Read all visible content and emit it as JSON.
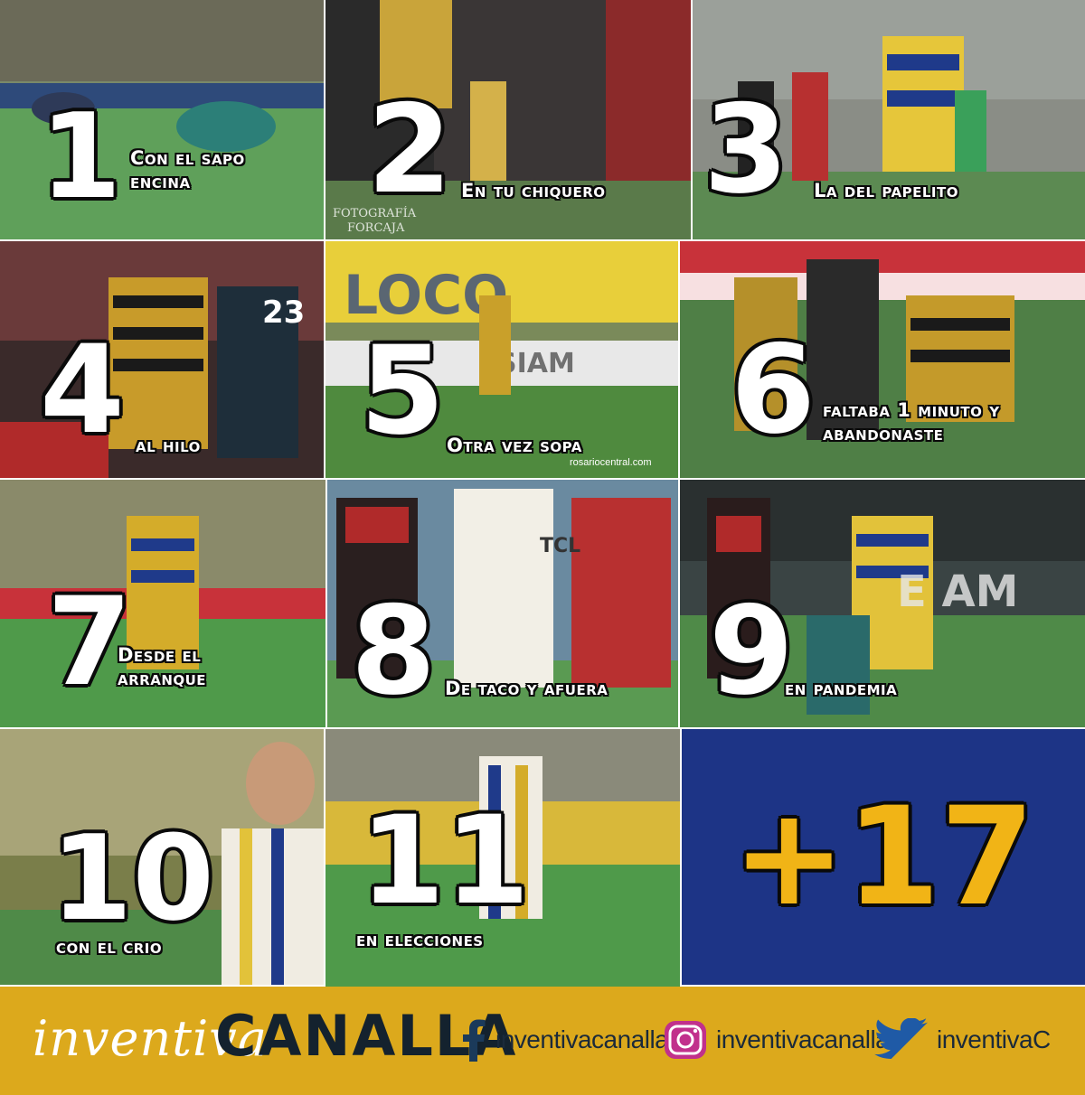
{
  "tiles": [
    {
      "number": "1",
      "caption": "Con el sapo encina"
    },
    {
      "number": "2",
      "caption": "En tu chiquero"
    },
    {
      "number": "3",
      "caption": "La del papelito"
    },
    {
      "number": "4",
      "caption": "al hilo"
    },
    {
      "number": "5",
      "caption": "Otra vez sopa"
    },
    {
      "number": "6",
      "caption": "faltaba 1 minuto y abandonaste"
    },
    {
      "number": "7",
      "caption": "Desde el arranque"
    },
    {
      "number": "8",
      "caption": "De taco y afuera"
    },
    {
      "number": "9",
      "caption": "en pandemia"
    },
    {
      "number": "10",
      "caption": "con el crio"
    },
    {
      "number": "11",
      "caption": "en elecciones"
    }
  ],
  "total_badge": "+17",
  "footer": {
    "brand_script": "inventiva",
    "brand_caps": "CANALLA",
    "facebook": "inventivacanalla",
    "instagram": "inventivacanalla",
    "twitter": "inventivaC"
  },
  "photo_watermarks": {
    "tile2": "FOTOGRAFÍA FORCAJA",
    "tile5": "rosariocentral.com"
  },
  "colors": {
    "badge_bg": "#1d3486",
    "badge_text": "#f1b416",
    "footer_bg": "#dca91c",
    "caption_text": "#ffffff",
    "brand_dark": "#14222e",
    "social_blue": "#1f5aa6"
  },
  "icons": [
    "facebook-icon",
    "instagram-icon",
    "twitter-icon"
  ]
}
